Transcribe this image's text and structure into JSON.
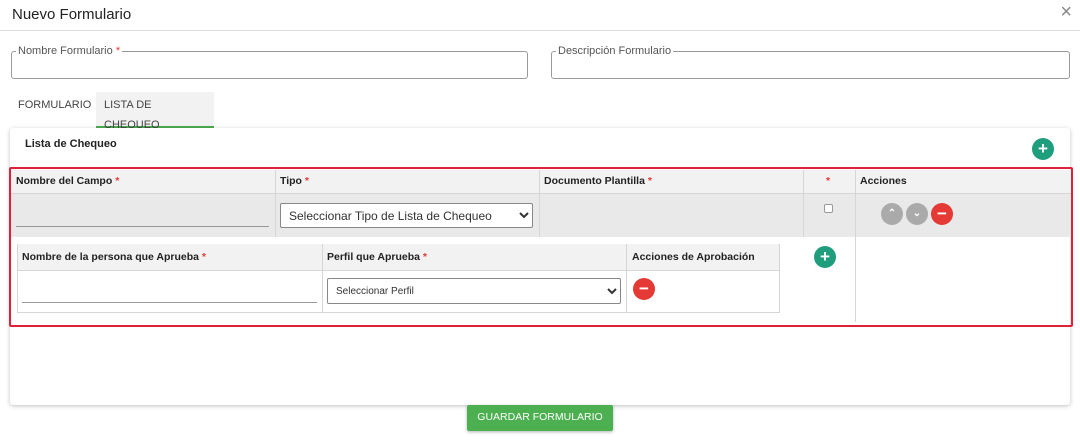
{
  "modal": {
    "title": "Nuevo Formulario",
    "close_glyph": "×"
  },
  "fields": {
    "nombre_label": "Nombre Formulario",
    "nombre_value": "",
    "descripcion_label": "Descripción Formulario",
    "descripcion_value": "",
    "required_mark": "*"
  },
  "tabs": [
    {
      "label": "FORMULARIO",
      "active": false
    },
    {
      "label": "LISTA DE CHEQUEO",
      "active": true
    }
  ],
  "card": {
    "title": "Lista de Chequeo"
  },
  "table": {
    "headers": {
      "nombre_campo": "Nombre del Campo",
      "tipo": "Tipo",
      "documento": "Documento Plantilla",
      "required_col": "*",
      "acciones": "Acciones"
    },
    "row": {
      "nombre_campo_value": "",
      "tipo_selected": "Seleccionar Tipo de Lista de Chequeo",
      "required_checked": false
    }
  },
  "approval": {
    "headers": {
      "persona": "Nombre de la persona que Aprueba",
      "perfil": "Perfil que Aprueba",
      "acciones": "Acciones de Aprobación"
    },
    "row": {
      "persona_value": "",
      "perfil_selected": "Seleccionar Perfil"
    }
  },
  "icons": {
    "add": "+",
    "remove": "−",
    "up": "⌃",
    "down": "⌄"
  },
  "footer": {
    "save_label": "GUARDAR FORMULARIO"
  },
  "colors": {
    "accent_green": "#4caf50",
    "add_green": "#1f9e7e",
    "remove_red": "#e53935",
    "highlight": "#e0213a"
  }
}
